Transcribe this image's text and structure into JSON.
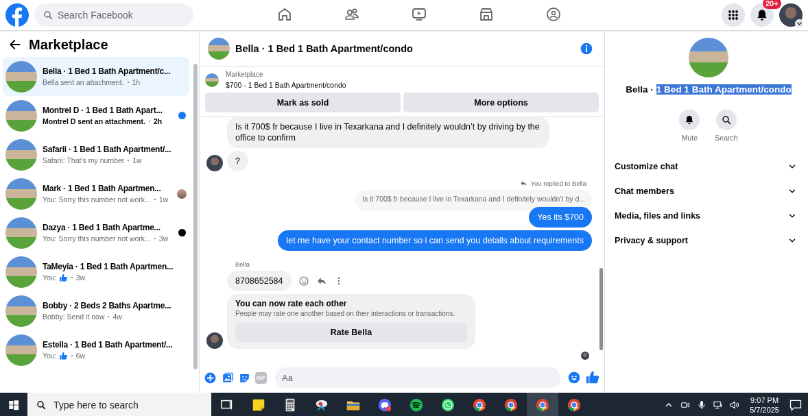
{
  "topbar": {
    "search": {
      "placeholder": "Search Facebook"
    },
    "nav_tabs": [
      {
        "selected": false
      },
      {
        "selected": false
      },
      {
        "selected": false
      },
      {
        "selected": false
      },
      {
        "selected": false
      }
    ],
    "notifications_badge": "20+"
  },
  "sidebar": {
    "title": "Marketplace",
    "conversations": [
      {
        "title": "Bella · 1 Bed 1 Bath Apartment/c...",
        "preview": "Bella sent an attachment.",
        "time": "1h",
        "selected": true,
        "unread": false
      },
      {
        "title": "Montrel D · 1 Bed 1 Bath Apart...",
        "preview": "Montrel D sent an attachment.",
        "time": "2h",
        "selected": false,
        "unread": true,
        "indicator": {
          "kind": "dot",
          "color": "#1877f2"
        }
      },
      {
        "title": "Safarii · 1 Bed 1 Bath Apartment/...",
        "preview": "Safarii: That’s my number",
        "time": "1w",
        "selected": false,
        "unread": false
      },
      {
        "title": "Mark · 1 Bed 1 Bath Apartmen...",
        "preview": "You: Sorry this number not work...",
        "time": "1w",
        "selected": false,
        "unread": false,
        "indicator": {
          "kind": "avatar"
        }
      },
      {
        "title": "Dazya · 1 Bed 1 Bath Apartme...",
        "preview": "You: Sorry this number not work...",
        "time": "3w",
        "selected": false,
        "unread": false,
        "indicator": {
          "kind": "dot",
          "color": "#000000"
        }
      },
      {
        "title": "TaMeyia · 1 Bed 1 Bath Apartmen...",
        "preview": "You:",
        "liked": true,
        "time": "3w",
        "selected": false,
        "unread": false
      },
      {
        "title": "Bobby · 2 Beds 2 Baths Apartme...",
        "preview": "Bobby: Send it now",
        "time": "4w",
        "selected": false,
        "unread": false
      },
      {
        "title": "Estella · 1 Bed 1 Bath Apartment/...",
        "preview": "You:",
        "liked": true,
        "time": "6w",
        "selected": false,
        "unread": false
      }
    ]
  },
  "chat": {
    "title": "Bella · 1 Bed 1 Bath Apartment/condo",
    "listing": {
      "source": "Marketplace",
      "summary": "$700 - 1 Bed 1 Bath Apartment/condo",
      "buttons": [
        "Mark as sold",
        "More options"
      ]
    },
    "messages": [
      {
        "kind": "incoming",
        "text": "Is it 700$ fr because I live in Texarkana and I definitely wouldn’t by driving by the office to confirm",
        "avatar": false,
        "actions": false
      },
      {
        "kind": "incoming",
        "text": "?",
        "avatar": true,
        "actions": false
      },
      {
        "kind": "reply-note",
        "text": "You replied to Bella"
      },
      {
        "kind": "quoted",
        "text": "Is it 700$ fr because I live in Texarkana and I definitely wouldn’t by d..."
      },
      {
        "kind": "outgoing",
        "text": "Yes its $700"
      },
      {
        "kind": "outgoing",
        "text": "let me have your contact number so i can send you details about requirements"
      },
      {
        "kind": "sender",
        "text": "Bella"
      },
      {
        "kind": "incoming",
        "text": "8708652584",
        "avatar": false,
        "actions": true
      },
      {
        "kind": "rating-card",
        "title": "You can now rate each other",
        "text": "People may rate one another based on their interactions or transactions.",
        "button": "Rate Bella",
        "avatar": true
      }
    ],
    "read_receipt": true,
    "composer": {
      "gif_label": "GIF",
      "placeholder": "Aa"
    }
  },
  "details": {
    "title": [
      {
        "text": "Bella ·",
        "highlighted": false
      },
      {
        "text": "1 Bed 1 Bath Apartment/condo",
        "highlighted": true
      }
    ],
    "actions": [
      "Mute",
      "Search"
    ],
    "sections": [
      {
        "label": "Customize chat",
        "expanded": false
      },
      {
        "label": "Chat members",
        "expanded": false
      },
      {
        "label": "Media, files and links",
        "expanded": false
      },
      {
        "label": "Privacy & support",
        "expanded": false
      }
    ]
  },
  "taskbar": {
    "search_placeholder": "Type here to search",
    "apps": [
      {
        "active": false
      },
      {
        "active": false
      },
      {
        "active": false
      },
      {
        "active": false
      },
      {
        "active": false
      },
      {
        "active": false
      },
      {
        "active": false
      },
      {
        "active": false
      },
      {
        "active": false
      },
      {
        "active": false
      },
      {
        "active": true
      },
      {
        "active": false
      }
    ],
    "time": "9:07 PM",
    "date": "5/7/2025"
  }
}
